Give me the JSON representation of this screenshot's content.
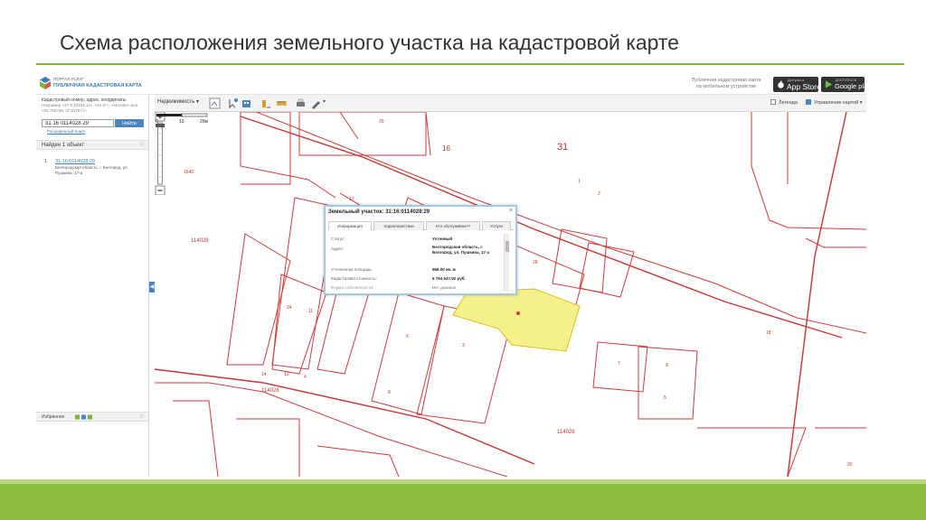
{
  "slide": {
    "title": "Схема расположения земельного участка на кадастровой карте",
    "accent_color": "#8cbd3f"
  },
  "header": {
    "logo_small": "ПОРТАЛ УСЛУГ",
    "logo_main": "ПУБЛИЧНАЯ КАДАСТРОВАЯ КАРТА",
    "promo_line1": "Публичная кадастровая карта",
    "promo_line2": "на мобильном устройстве",
    "appstore_small": "Доступно в",
    "appstore_big": "App Store",
    "googleplay_small": "ДОСТУПНО В",
    "googleplay_big": "Google play"
  },
  "left_panel": {
    "search_label": "Кадастровый номер, адрес, координаты",
    "search_hint": "Например «47:8:10104:12», «61:5*», «Москва» или «55.755768, 37.617671»",
    "search_value": "31 16 0114028 29",
    "search_button": "Найти",
    "advanced_link": "Расширенный поиск",
    "found_label": "Найден 1 объект",
    "result_number": "1.",
    "result_link": "31:16:0114028:29",
    "result_address": "Белгородская область, г. Белгород, ул. Пушкина, 17-а",
    "favorites_label": "Избранное"
  },
  "toolbar": {
    "layer_label": "Недвижимость",
    "legend_label": "Легенда",
    "map_control_label": "Управление картой"
  },
  "popup": {
    "title": "Земельный участок: 31:16:0114028:29",
    "close": "×",
    "tabs": [
      "Информация",
      "Характеристики",
      "Кто обслуживает?",
      "Услуги"
    ],
    "rows": [
      {
        "label": "Статус:",
        "value": "Учтенный"
      },
      {
        "label": "Адрес:",
        "value": "Белгородская область, г. Белгород, ул. Пушкина, 17-а"
      },
      {
        "label": "Уточненная площадь:",
        "value": "966.00 кв. м"
      },
      {
        "label": "Кадастровая стоимость:",
        "value": "6 764 647.92 руб."
      },
      {
        "label": "Форма собственности:",
        "value": "Нет данных"
      }
    ]
  },
  "map": {
    "labels": [
      {
        "text": "29"
      },
      {
        "text": "16"
      },
      {
        "text": "31"
      },
      {
        "text": "17"
      },
      {
        "text": "114028"
      },
      {
        "text": "1"
      },
      {
        "text": "2"
      },
      {
        "text": "28"
      },
      {
        "text": "24"
      },
      {
        "text": "11"
      },
      {
        "text": "6"
      },
      {
        "text": "3"
      },
      {
        "text": "8"
      },
      {
        "text": "4"
      },
      {
        "text": "14"
      },
      {
        "text": "13"
      },
      {
        "text": "114028"
      },
      {
        "text": "7"
      },
      {
        "text": "9"
      },
      {
        "text": "5"
      },
      {
        "text": "114028"
      },
      {
        "text": "20"
      },
      {
        "text": "1640"
      },
      {
        "text": "18"
      }
    ],
    "scale_labels": [
      "0",
      "10",
      "20м"
    ],
    "parcel_line_color": "#d23a3a",
    "highlight_color": "#f4f08c"
  }
}
